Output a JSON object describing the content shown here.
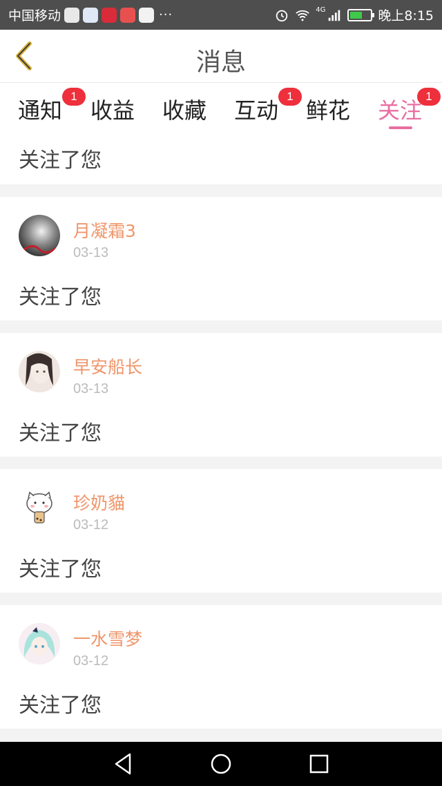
{
  "status_bar": {
    "carrier": "中国移动",
    "more": "···",
    "network": "4G",
    "time": "晚上8:15",
    "battery_level": 0.6
  },
  "header": {
    "title": "消息",
    "back_icon": "chevron-left-icon"
  },
  "tabs": [
    {
      "label": "通知",
      "badge": "1",
      "active": false
    },
    {
      "label": "收益",
      "badge": "",
      "active": false
    },
    {
      "label": "收藏",
      "badge": "",
      "active": false
    },
    {
      "label": "互动",
      "badge": "1",
      "active": false
    },
    {
      "label": "鲜花",
      "badge": "",
      "active": false
    },
    {
      "label": "关注",
      "badge": "1",
      "active": true
    }
  ],
  "messages": {
    "partial_text": "关注了您",
    "items": [
      {
        "name": "月凝霜3",
        "date": "03-13",
        "text": "关注了您"
      },
      {
        "name": "早安船长",
        "date": "03-13",
        "text": "关注了您"
      },
      {
        "name": "珍奶貓",
        "date": "03-12",
        "text": "关注了您"
      },
      {
        "name": "一水雪梦",
        "date": "03-12",
        "text": "关注了您"
      }
    ]
  },
  "colors": {
    "accent": "#e96fa2",
    "username": "#f0956a",
    "badge": "#ee2f3c",
    "back_arrow": "#d4b13a"
  }
}
